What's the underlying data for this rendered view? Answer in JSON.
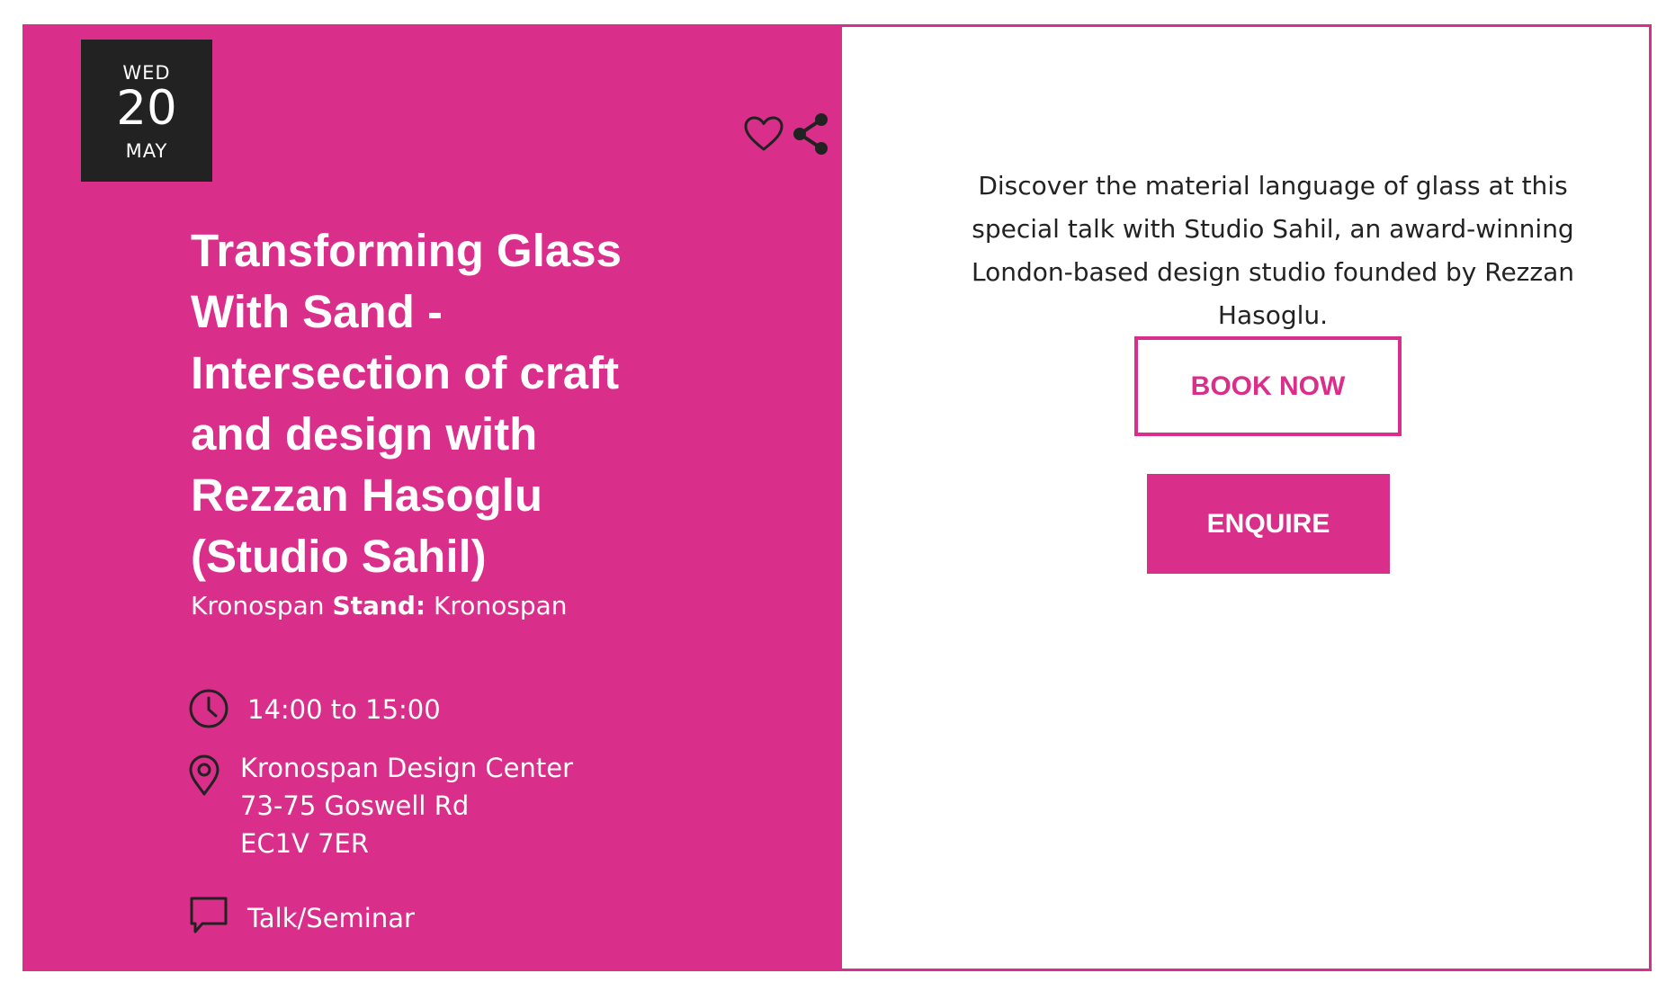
{
  "colors": {
    "accent": "#d92e89",
    "dark": "#222222",
    "white": "#ffffff"
  },
  "date": {
    "weekday": "WED",
    "day": "20",
    "month": "MAY"
  },
  "actions": {
    "favorite_icon": "heart-icon",
    "share_icon": "share-icon"
  },
  "event": {
    "title": "Transforming Glass With Sand - Intersection of craft and design with Rezzan Hasoglu (Studio Sahil)",
    "organizer": "Kronospan",
    "stand_label": "Stand:",
    "stand": "Kronospan",
    "time": "14:00 to 15:00",
    "venue_lines": [
      "Kronospan Design Center",
      "73-75 Goswell Rd",
      "EC1V 7ER"
    ],
    "category": "Talk/Seminar"
  },
  "description": "Discover the material language of glass at this special talk with Studio Sahil, an award-winning London-based design studio founded by Rezzan Hasoglu.",
  "buttons": {
    "book": "BOOK NOW",
    "enquire": "ENQUIRE"
  }
}
